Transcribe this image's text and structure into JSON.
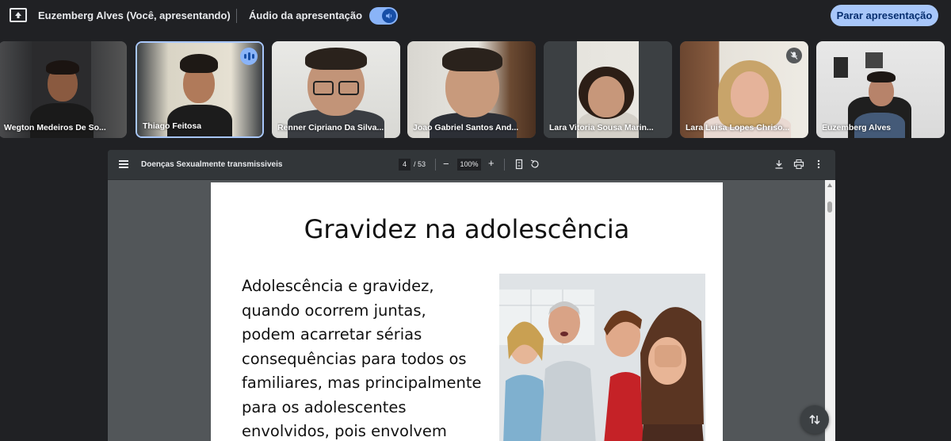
{
  "topbar": {
    "presenter_name": "Euzemberg Alves (Você, apresentando)",
    "audio_label": "Áudio da apresentação",
    "audio_enabled": true,
    "stop_label": "Parar apresentação",
    "accent_color": "#a8c7fa"
  },
  "participants": [
    {
      "name": "Wegton Medeiros De So...",
      "speaking": false,
      "muted": false
    },
    {
      "name": "Thiago Feitosa",
      "speaking": true,
      "muted": false
    },
    {
      "name": "Renner Cipriano Da Silva...",
      "speaking": false,
      "muted": false
    },
    {
      "name": "Joao Gabriel Santos And...",
      "speaking": false,
      "muted": false
    },
    {
      "name": "Lara Vitoria Sousa Marin...",
      "speaking": false,
      "muted": false
    },
    {
      "name": "Lara Luisa Lopes Chriso...",
      "speaking": false,
      "muted": true
    },
    {
      "name": "Euzemberg Alves",
      "speaking": false,
      "muted": false
    }
  ],
  "viewer": {
    "doc_title": "Doenças Sexualmente transmissiveis",
    "current_page": "4",
    "total_pages": "/ 53",
    "zoom": "100%",
    "zoom_out": "−",
    "zoom_in": "+"
  },
  "slide": {
    "title": "Gravidez na adolescência",
    "body_lines": [
      "Adolescência e gravidez,",
      "quando ocorrem juntas,",
      "podem acarretar sérias",
      "consequências para todos os",
      "familiares, mas principalmente",
      "para os adolescentes",
      "envolvidos, pois envolvem"
    ]
  },
  "icons": {
    "present": "present-screen-icon",
    "speaker": "speaker-icon",
    "menu": "menu-icon",
    "fit": "fit-page-icon",
    "rotate": "rotate-icon",
    "download": "download-icon",
    "print": "print-icon",
    "more": "more-vert-icon",
    "swap": "swap-layout-icon"
  }
}
